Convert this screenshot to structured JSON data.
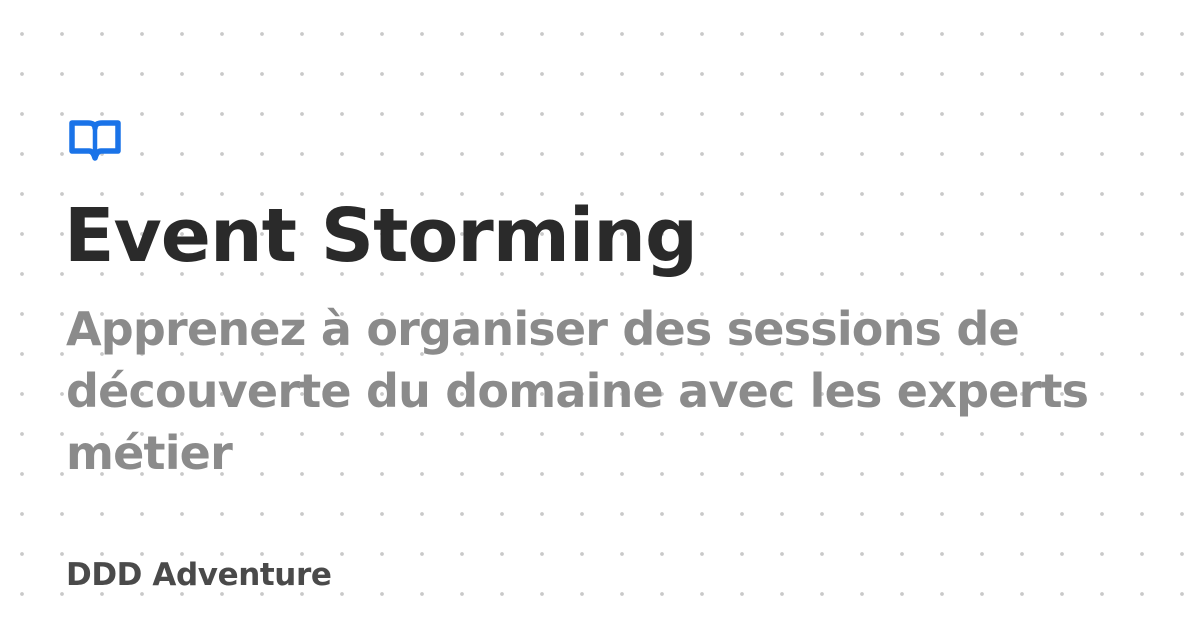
{
  "card": {
    "title": "Event Storming",
    "subtitle": "Apprenez à organiser des sessions de découverte du domaine avec les experts métier",
    "brand": "DDD Adventure",
    "icon": "book-open-icon"
  },
  "colors": {
    "accent": "#1a73e8",
    "title": "#2a2a2a",
    "subtitle": "#8b8b8b",
    "brand": "#4a4a4a",
    "dots": "#c9c9c9"
  }
}
